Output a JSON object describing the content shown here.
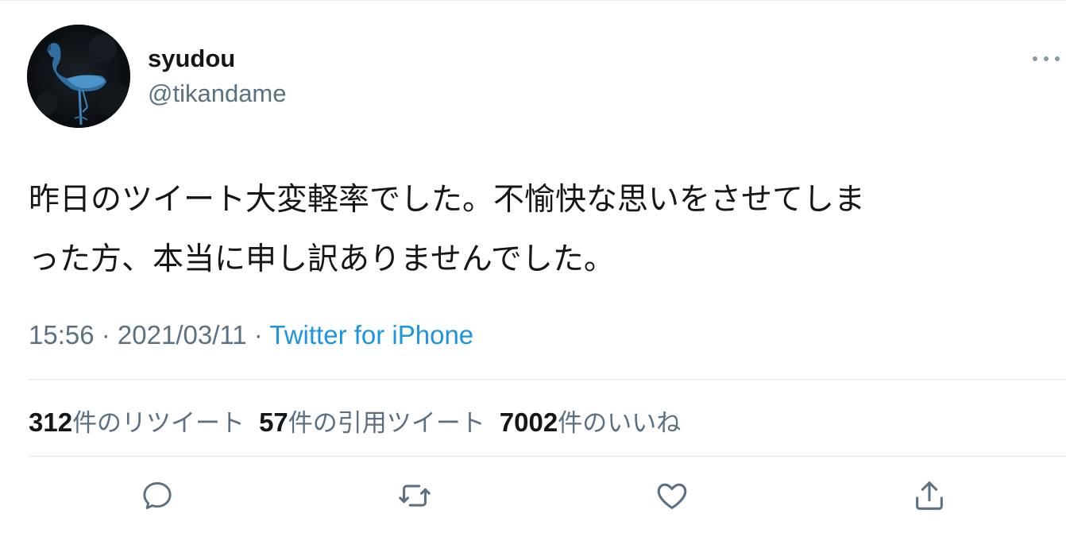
{
  "tweet": {
    "display_name": "syudou",
    "handle": "@tikandame",
    "more_label": "•••",
    "text_line1": "昨日のツイート大変軽率でした。不愉快な思いをさせてしま",
    "text_line2": "った方、本当に申し訳ありませんでした。",
    "time": "15:56",
    "separator1": " · ",
    "date": "2021/03/11",
    "separator2": " · ",
    "source": "Twitter for iPhone"
  },
  "stats": {
    "retweets_count": "312",
    "retweets_label": "件のリツイート",
    "quotes_count": "57",
    "quotes_label": "件の引用ツイート",
    "likes_count": "7002",
    "likes_label": "件のいいね"
  },
  "actions": [
    "reply-icon",
    "retweet-icon",
    "like-icon",
    "share-icon"
  ],
  "colors": {
    "text": "#14171a",
    "secondary": "#5b7083",
    "link": "#1b95e0",
    "divider": "#dfe5ea",
    "icon": "#5b7083"
  }
}
